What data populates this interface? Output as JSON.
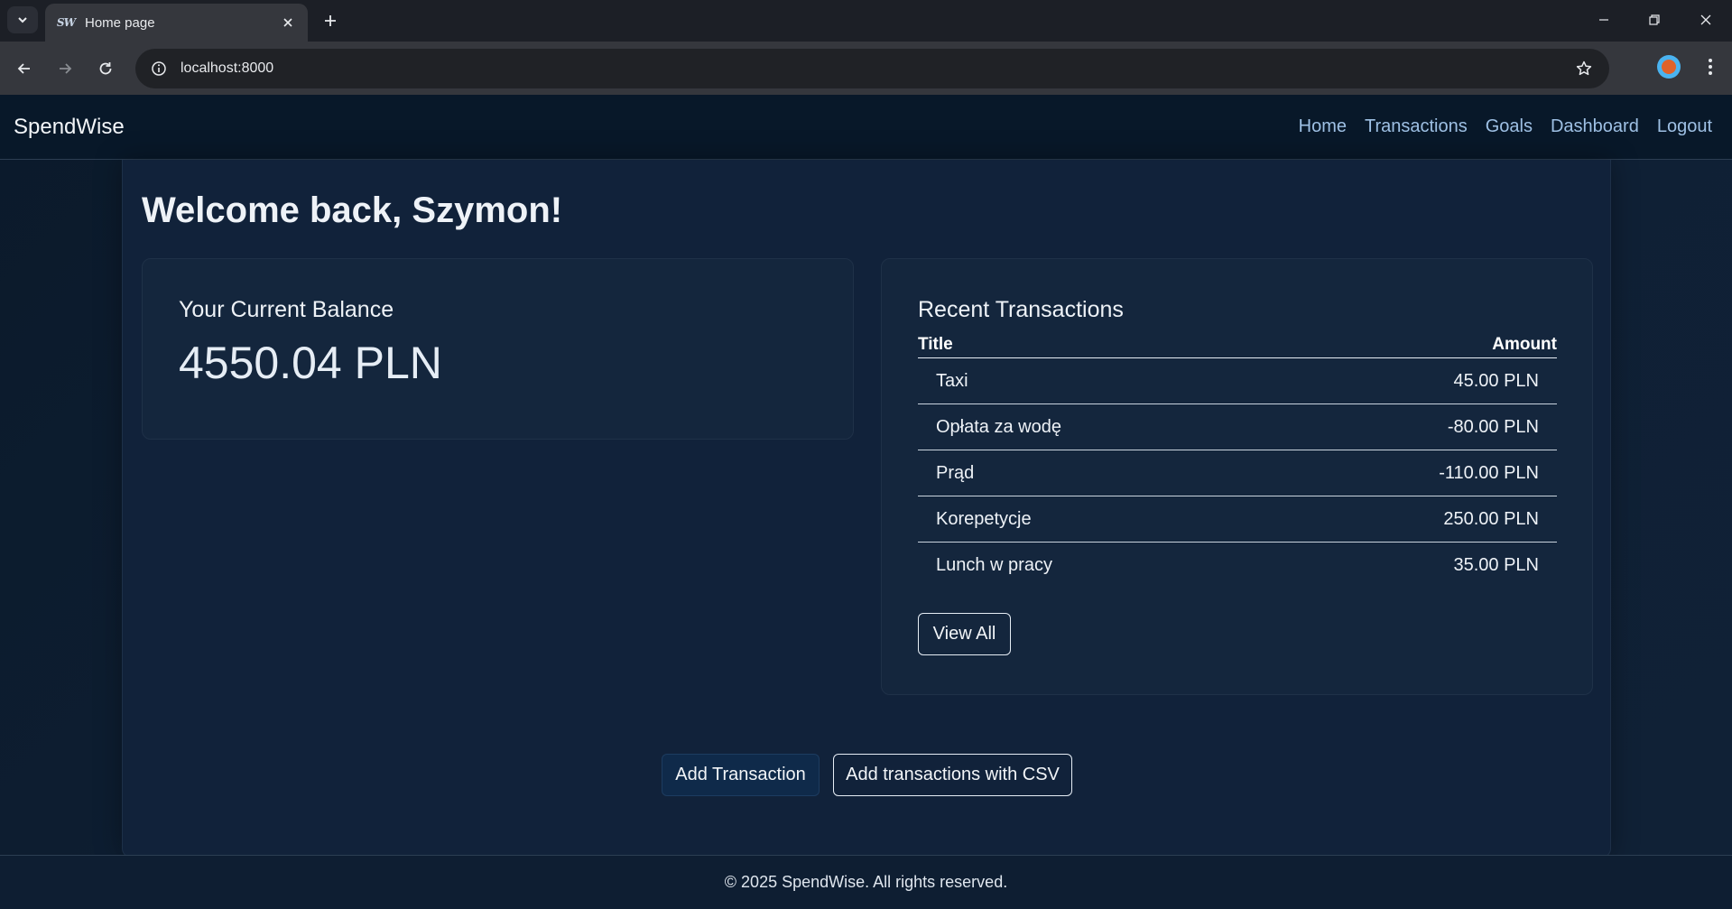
{
  "browser": {
    "tab": {
      "favicon_text": "SW",
      "title": "Home page"
    },
    "url": "localhost:8000",
    "icons": {
      "tab_list": "chevron-down-icon",
      "close_tab": "close-icon",
      "new_tab": "plus-icon",
      "back": "arrow-left-icon",
      "forward": "arrow-right-icon",
      "reload": "reload-icon",
      "site_info": "info-icon",
      "bookmark": "star-icon",
      "menu": "more-vertical-icon"
    }
  },
  "app": {
    "brand": "SpendWise",
    "nav": [
      {
        "label": "Home"
      },
      {
        "label": "Transactions"
      },
      {
        "label": "Goals"
      },
      {
        "label": "Dashboard"
      },
      {
        "label": "Logout"
      }
    ]
  },
  "main": {
    "welcome": "Welcome back, Szymon!",
    "balance": {
      "title": "Your Current Balance",
      "value": "4550.04 PLN"
    },
    "recent": {
      "title": "Recent Transactions",
      "columns": {
        "title": "Title",
        "amount": "Amount"
      },
      "rows": [
        {
          "title": "Taxi",
          "amount": "45.00 PLN"
        },
        {
          "title": "Opłata za wodę",
          "amount": "-80.00 PLN"
        },
        {
          "title": "Prąd",
          "amount": "-110.00 PLN"
        },
        {
          "title": "Korepetycje",
          "amount": "250.00 PLN"
        },
        {
          "title": "Lunch w pracy",
          "amount": "35.00 PLN"
        }
      ],
      "view_all": "View All"
    },
    "actions": {
      "add_transaction": "Add Transaction",
      "add_csv": "Add transactions with CSV"
    }
  },
  "footer": {
    "text": "© 2025 SpendWise. All rights reserved."
  },
  "colors": {
    "page_background": "#0c1b2c",
    "card_background": "#14263d",
    "nav_link": "#9ec0e4",
    "primary_button": "#0f2a4a"
  }
}
